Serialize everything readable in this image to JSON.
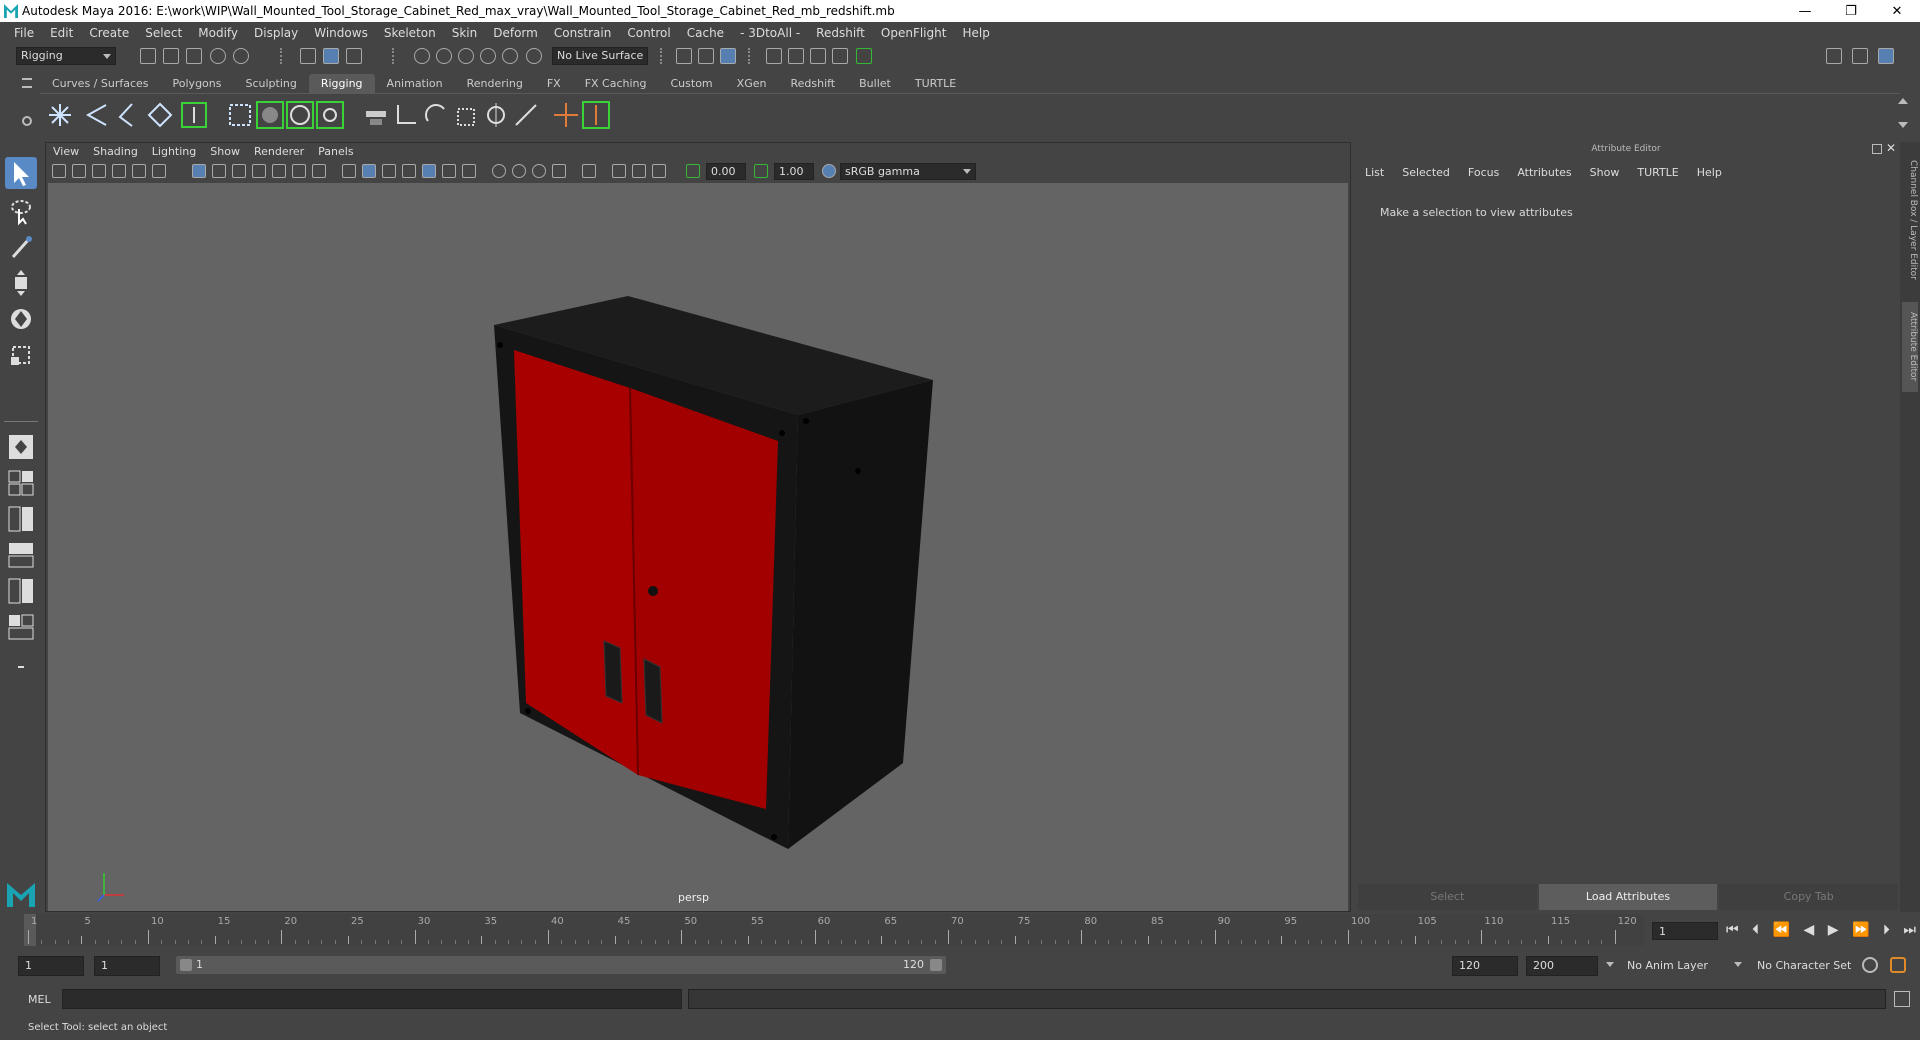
{
  "window": {
    "title": "Autodesk Maya 2016: E:\\work\\WIP\\Wall_Mounted_Tool_Storage_Cabinet_Red_max_vray\\Wall_Mounted_Tool_Storage_Cabinet_Red_mb_redshift.mb",
    "minimize": "—",
    "restore": "❐",
    "close": "✕"
  },
  "menubar": [
    "File",
    "Edit",
    "Create",
    "Select",
    "Modify",
    "Display",
    "Windows",
    "Skeleton",
    "Skin",
    "Deform",
    "Constrain",
    "Control",
    "Cache",
    "- 3DtoAll -",
    "Redshift",
    "OpenFlight",
    "Help"
  ],
  "statusline": {
    "menuset": "Rigging",
    "live_surface": "No Live Surface"
  },
  "shelf": {
    "tabs": [
      "Curves / Surfaces",
      "Polygons",
      "Sculpting",
      "Rigging",
      "Animation",
      "Rendering",
      "FX",
      "FX Caching",
      "Custom",
      "XGen",
      "Redshift",
      "Bullet",
      "TURTLE"
    ],
    "active_tab": "Rigging"
  },
  "viewport": {
    "menu": [
      "View",
      "Shading",
      "Lighting",
      "Show",
      "Renderer",
      "Panels"
    ],
    "exposure": "0.00",
    "gamma": "1.00",
    "color_space": "sRGB gamma",
    "camera_label": "persp"
  },
  "attribute_editor": {
    "title": "Attribute Editor",
    "menu": [
      "List",
      "Selected",
      "Focus",
      "Attributes",
      "Show",
      "TURTLE",
      "Help"
    ],
    "message": "Make a selection to view attributes",
    "buttons": [
      "Select",
      "Load Attributes",
      "Copy Tab"
    ]
  },
  "side_tabs": [
    "Channel Box / Layer Editor",
    "Attribute Editor"
  ],
  "timeline": {
    "ticks": [
      "1",
      "5",
      "10",
      "15",
      "20",
      "25",
      "30",
      "35",
      "40",
      "45",
      "50",
      "55",
      "60",
      "65",
      "70",
      "75",
      "80",
      "85",
      "90",
      "95",
      "100",
      "105",
      "110",
      "115",
      "120"
    ],
    "current_frame": "1"
  },
  "range": {
    "start": "1",
    "anim_start": "1",
    "slider_start": "1",
    "slider_end": "120",
    "end": "120",
    "anim_end": "200",
    "anim_layer": "No Anim Layer",
    "character_set": "No Character Set"
  },
  "command": {
    "label": "MEL"
  },
  "help_line": "Select Tool: select an object",
  "colors": {
    "cabinet_body": "#151515",
    "cabinet_door": "#a50000",
    "viewport_bg": "#646464",
    "accent": "#5a8ac6"
  }
}
